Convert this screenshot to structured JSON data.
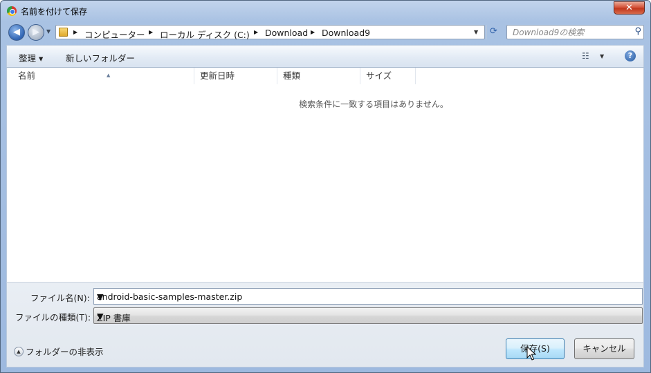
{
  "window": {
    "title": "名前を付けて保存",
    "close_glyph": "✕"
  },
  "address": {
    "breadcrumbs": [
      "コンピューター",
      "ローカル ディスク (C:)",
      "Download",
      "Download9"
    ],
    "search_placeholder": "Download9の検索"
  },
  "toolbar": {
    "organize_label": "整理 ▾",
    "new_folder_label": "新しいフォルダー"
  },
  "file_list": {
    "columns": [
      "名前",
      "更新日時",
      "種類",
      "サイズ"
    ],
    "empty_message": "検索条件に一致する項目はありません。"
  },
  "form": {
    "filename_label": "ファイル名(N):",
    "filename_value": "android-basic-samples-master.zip",
    "filetype_label": "ファイルの種類(T):",
    "filetype_value": "ZIP 書庫"
  },
  "footer": {
    "hide_folders_label": "フォルダーの非表示",
    "save_label": "保存(S)",
    "cancel_label": "キャンセル"
  },
  "icons": {
    "app": "chrome-icon",
    "back": "back-arrow-icon",
    "forward": "forward-arrow-icon",
    "folder": "folder-icon",
    "refresh": "refresh-icon",
    "search": "search-icon",
    "view": "view-options-icon",
    "help": "help-icon",
    "hide": "collapse-up-icon"
  }
}
